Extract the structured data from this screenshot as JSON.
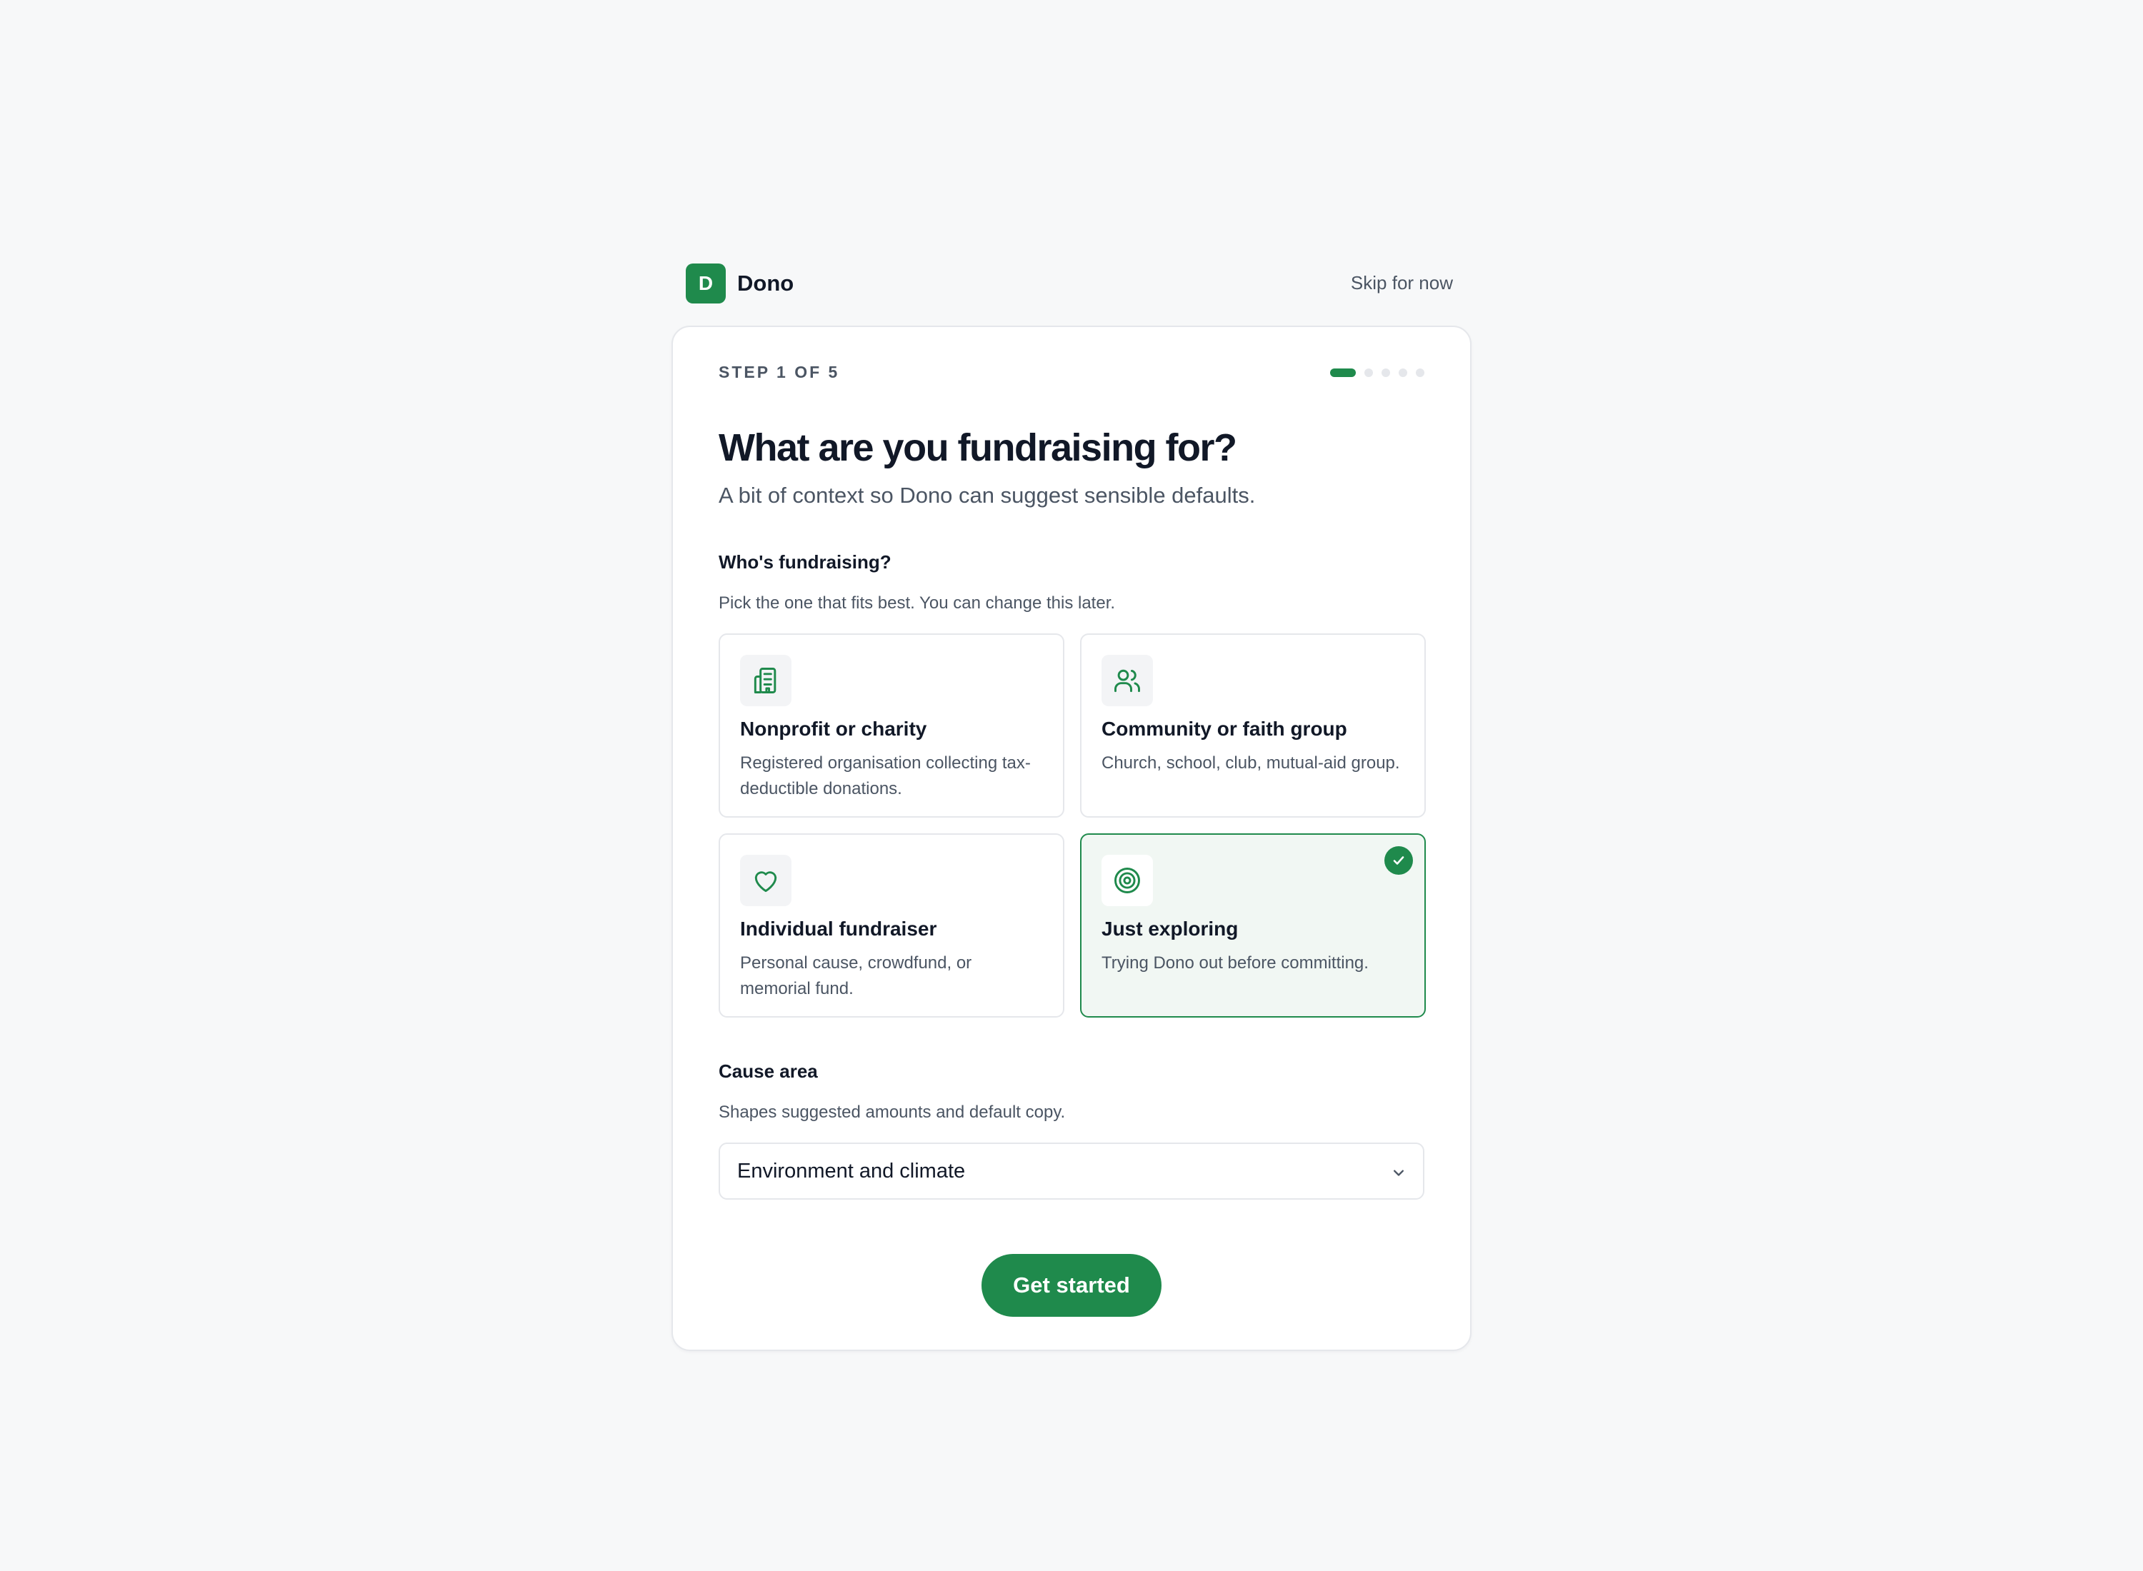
{
  "brand": {
    "initial": "D",
    "name": "Dono"
  },
  "header": {
    "skip_label": "Skip for now"
  },
  "step": {
    "label": "STEP 1 OF 5",
    "current": 1,
    "total": 5
  },
  "colors": {
    "accent": "#1f8a4c",
    "selected_bg": "#f1f7f3",
    "border": "#e5e7eb",
    "muted_text": "#4b5563"
  },
  "main": {
    "title": "What are you fundraising for?",
    "subtitle": "A bit of context so Dono can suggest sensible defaults."
  },
  "who": {
    "label": "Who's fundraising?",
    "help": "Pick the one that fits best. You can change this later.",
    "selected": "Just exploring",
    "options": [
      {
        "icon": "building-icon",
        "title": "Nonprofit or charity",
        "desc": "Registered organisation collecting tax-deductible donations."
      },
      {
        "icon": "people-icon",
        "title": "Community or faith group",
        "desc": "Church, school, club, mutual-aid group."
      },
      {
        "icon": "heart-icon",
        "title": "Individual fundraiser",
        "desc": "Personal cause, crowdfund, or memorial fund."
      },
      {
        "icon": "target-icon",
        "title": "Just exploring",
        "desc": "Trying Dono out before committing."
      }
    ]
  },
  "cause": {
    "label": "Cause area",
    "help": "Shapes suggested amounts and default copy.",
    "value": "Environment and climate"
  },
  "cta": {
    "label": "Get started"
  }
}
